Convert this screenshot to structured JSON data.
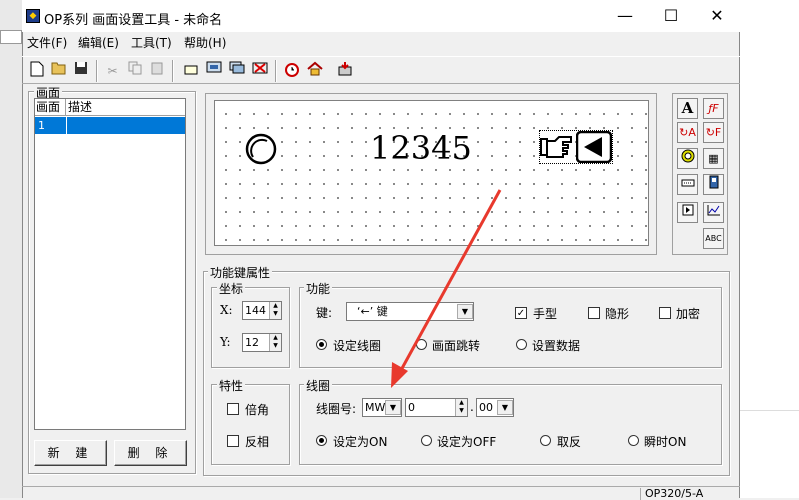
{
  "window": {
    "title": "OP系列 画面设置工具 - 未命名",
    "minimize": "—",
    "maximize": "☐",
    "close": "✕"
  },
  "menu": [
    "文件(F)",
    "编辑(E)",
    "工具(T)",
    "帮助(H)"
  ],
  "screen_panel": {
    "label": "画面",
    "columns": [
      "画面",
      "描述"
    ],
    "rows": [
      {
        "id": "1",
        "desc": ""
      }
    ],
    "new_button": "新 建",
    "delete_button": "删 除"
  },
  "canvas": {
    "number_text": "12345"
  },
  "palette": {
    "text_tool": "A",
    "abc_tool": "ABC"
  },
  "properties": {
    "label": "功能键属性",
    "coords": {
      "label": "坐标",
      "x_label": "X:",
      "x_value": "144",
      "y_label": "Y:",
      "y_value": "12"
    },
    "function": {
      "label": "功能",
      "key_label": "键:",
      "key_value": "‘←’ 键",
      "hand_label": "手型",
      "hand_checked": true,
      "hidden_label": "隐形",
      "hidden_checked": false,
      "encrypt_label": "加密",
      "encrypt_checked": false,
      "options": [
        "设定线圈",
        "画面跳转",
        "设置数据"
      ],
      "selected": 0
    },
    "features": {
      "label": "特性",
      "double_angle": "倍角",
      "inverse": "反相"
    },
    "coil": {
      "label": "线圈",
      "number_label": "线圈号:",
      "type": "MW",
      "value": "0",
      "sub": "00",
      "options": [
        "设定为ON",
        "设定为OFF",
        "取反",
        "瞬时ON"
      ],
      "selected": 0
    }
  },
  "status": {
    "model": "OP320/5-A"
  },
  "colors": {
    "selection": "#0078d7",
    "arrow": "#e8392d"
  }
}
